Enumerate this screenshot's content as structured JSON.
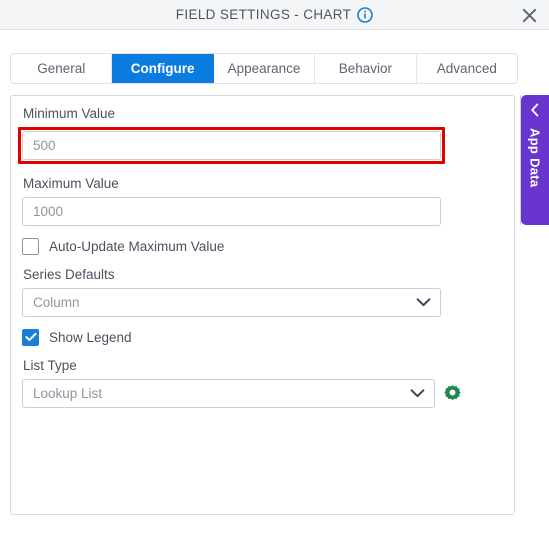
{
  "window": {
    "title": "FIELD SETTINGS - CHART",
    "info_icon": "info-circle-icon",
    "close_icon": "close-icon",
    "accent_blue": "#0b7cdf",
    "accent_purple": "#6a35cf",
    "accent_green": "#1f8a4c",
    "highlight_red": "#e00000"
  },
  "tabs": [
    {
      "label": "General",
      "active": false
    },
    {
      "label": "Configure",
      "active": true
    },
    {
      "label": "Appearance",
      "active": false
    },
    {
      "label": "Behavior",
      "active": false
    },
    {
      "label": "Advanced",
      "active": false
    }
  ],
  "form": {
    "minimum_value": {
      "label": "Minimum Value",
      "value": "500",
      "placeholder": "500",
      "highlighted": true
    },
    "maximum_value": {
      "label": "Maximum Value",
      "value": "1000",
      "placeholder": "1000",
      "highlighted": false
    },
    "auto_update": {
      "label": "Auto-Update Maximum Value",
      "checked": false
    },
    "series_defaults": {
      "label": "Series Defaults",
      "value": "Column",
      "chevron": "chevron-down-icon"
    },
    "show_legend": {
      "label": "Show Legend",
      "checked": true
    },
    "list_type": {
      "label": "List Type",
      "value": "Lookup List",
      "chevron": "chevron-down-icon",
      "settings_icon": "gear-icon"
    }
  },
  "side_panel": {
    "label": "App Data",
    "collapse_icon": "chevron-left-icon"
  }
}
